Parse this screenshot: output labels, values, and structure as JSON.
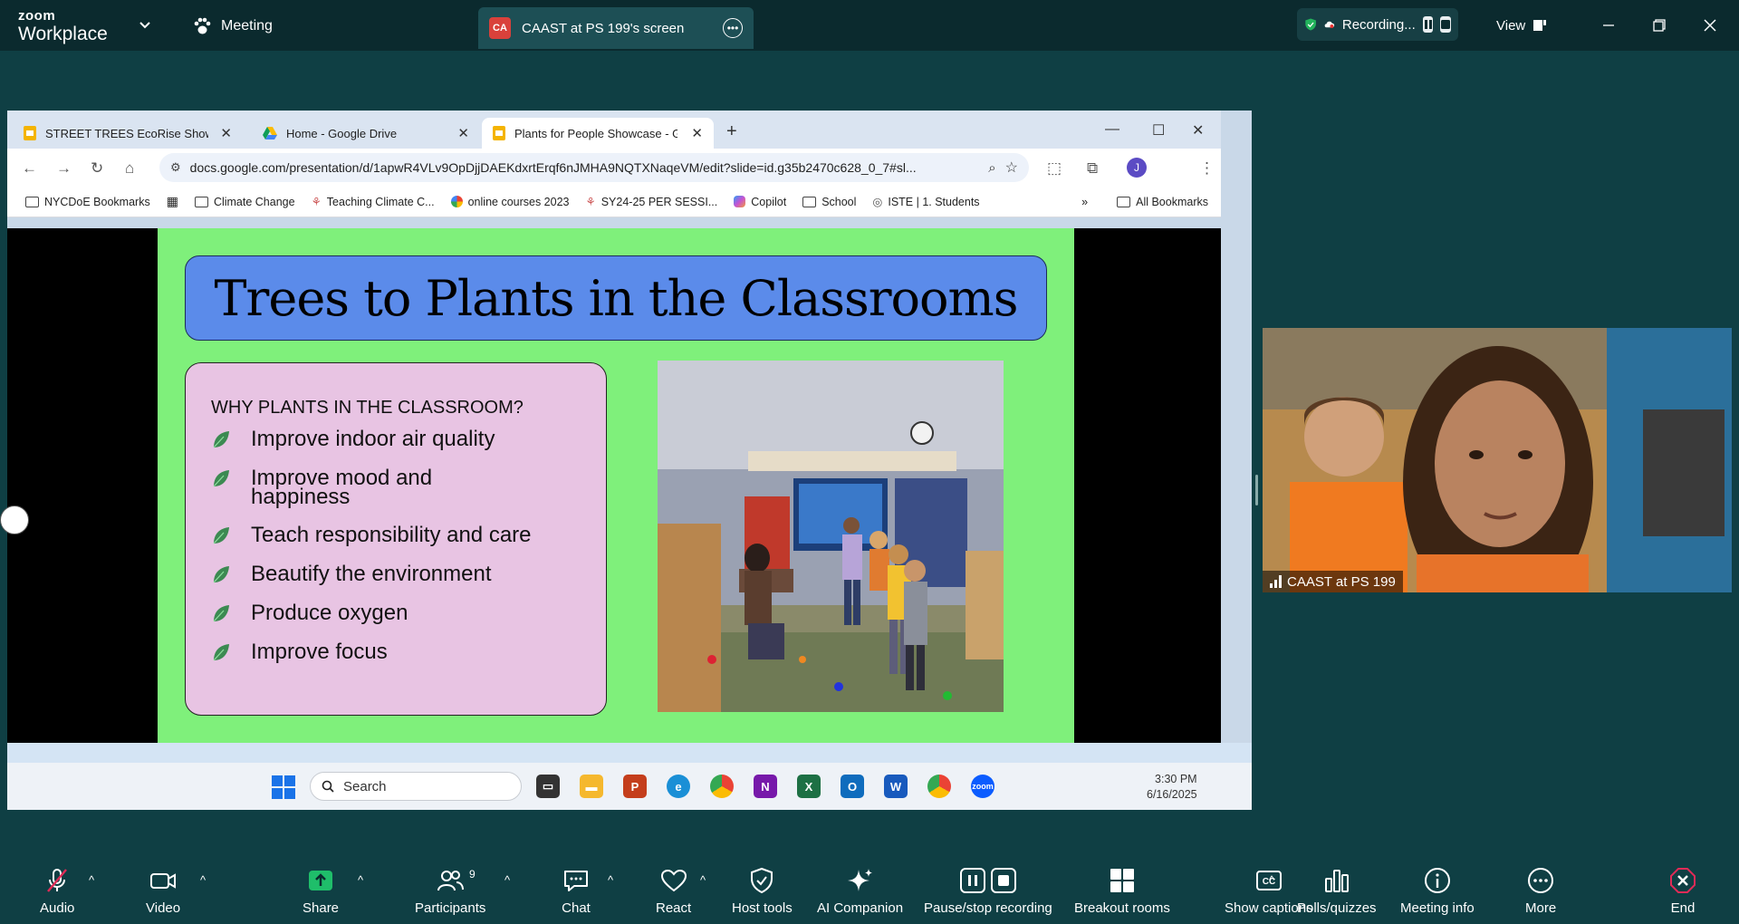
{
  "topbar": {
    "brand_top": "zoom",
    "brand_bottom": "Workplace",
    "meeting_label": "Meeting",
    "share_badge": "CA",
    "share_title": "CAAST at PS 199's screen",
    "recording_label": "Recording...",
    "view_label": "View"
  },
  "browser": {
    "tabs": [
      {
        "title": "STREET TREES EcoRise Showcase"
      },
      {
        "title": "Home - Google Drive"
      },
      {
        "title": "Plants for People Showcase - Google Slides"
      }
    ],
    "url": "docs.google.com/presentation/d/1apwR4VLv9OpDjjDAEKdxrtErqf6nJMHA9NQTXNaqeVM/edit?slide=id.g35b2470c628_0_7#sl...",
    "profile_initial": "J",
    "bookmarks": [
      "NYCDoE Bookmarks",
      "Climate Change",
      "Teaching Climate C...",
      "online courses 2023",
      "SY24-25 PER SESSI...",
      "Copilot",
      "School",
      "ISTE | 1. Students"
    ],
    "bookmarks_more": "»",
    "all_bookmarks": "All Bookmarks"
  },
  "slide": {
    "title": "Trees to Plants in the Classrooms",
    "list_heading": "WHY PLANTS IN THE CLASSROOM?",
    "items": [
      "Improve indoor air quality",
      "Improve mood and happiness",
      "Teach responsibility and care",
      "Beautify the environment",
      "Produce oxygen",
      "Improve focus"
    ]
  },
  "taskbar": {
    "search_placeholder": "Search",
    "time": "3:30 PM",
    "date": "6/16/2025"
  },
  "video": {
    "participant_name": "CAAST at PS 199"
  },
  "toolbar": {
    "audio": "Audio",
    "video": "Video",
    "share": "Share",
    "participants": "Participants",
    "participants_count": "9",
    "chat": "Chat",
    "react": "React",
    "host_tools": "Host tools",
    "ai_companion": "AI Companion",
    "pause_stop": "Pause/stop recording",
    "breakout": "Breakout rooms",
    "captions": "Show captions",
    "polls": "Polls/quizzes",
    "meeting_info": "Meeting info",
    "more": "More",
    "end": "End"
  },
  "colors": {
    "zoom_bg": "#0f3f44",
    "topbar_bg": "#0b2a2e",
    "slide_bg": "#7ff07b",
    "title_box": "#5b8bea",
    "list_box": "#e8c4e3",
    "share_green": "#1fbe6a",
    "end_red": "#e02b57"
  }
}
